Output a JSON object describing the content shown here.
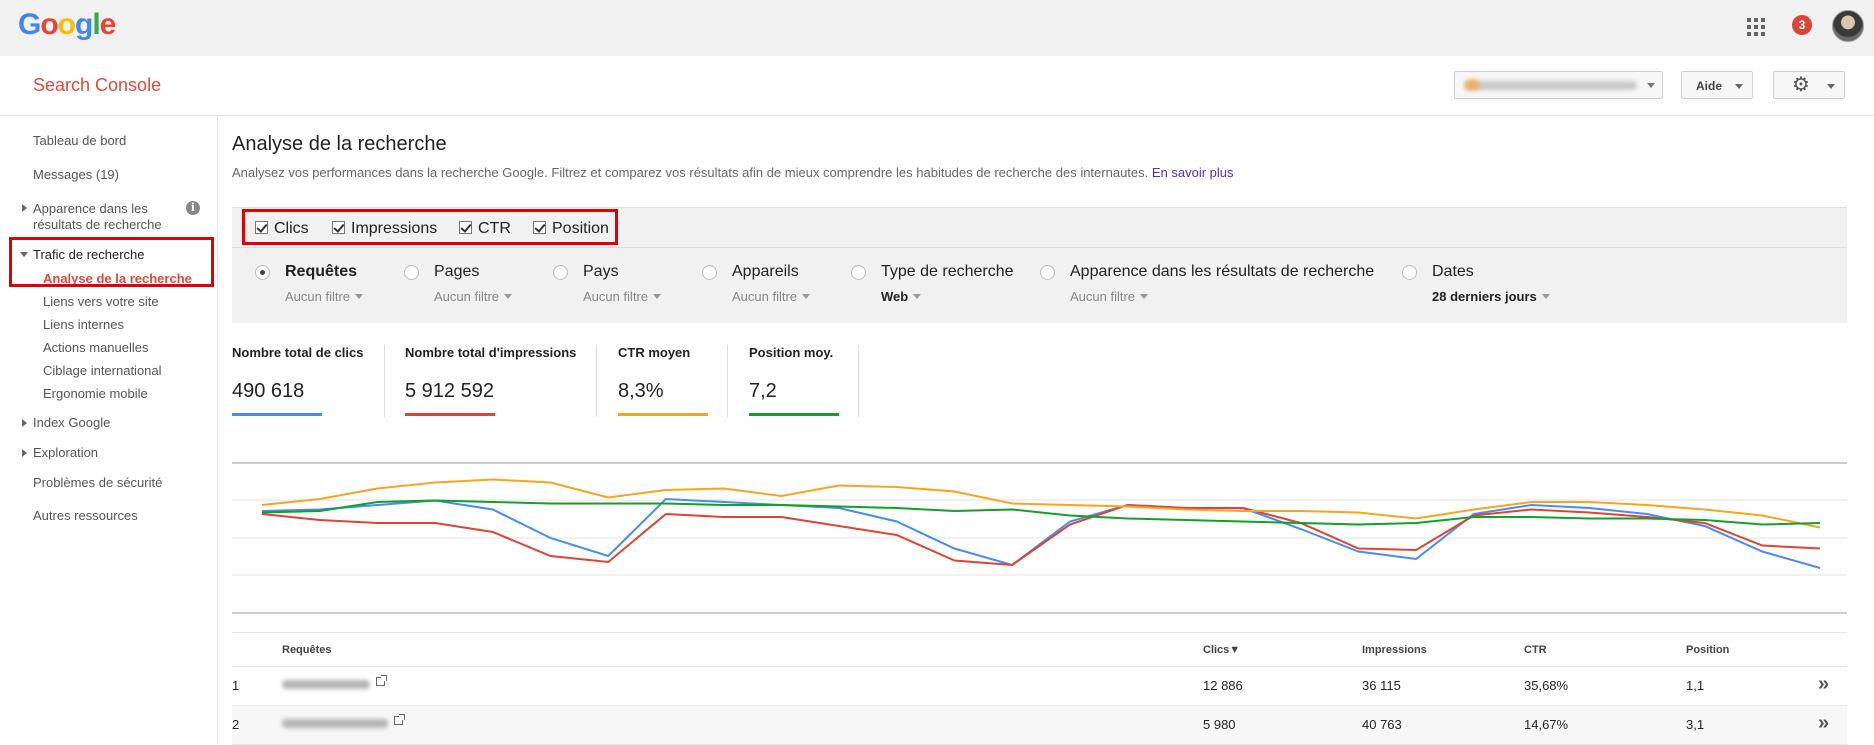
{
  "topbar": {
    "logo": [
      "G",
      "o",
      "o",
      "g",
      "l",
      "e"
    ],
    "logo_colors": [
      "#4285f4",
      "#ea4335",
      "#fbbc05",
      "#4285f4",
      "#34a853",
      "#ea4335"
    ],
    "notification_count": "3"
  },
  "header": {
    "title": "Search Console",
    "help_label": "Aide"
  },
  "sidebar": {
    "items": [
      {
        "label": "Tableau de bord"
      },
      {
        "label": "Messages (19)"
      },
      {
        "label": "Apparence dans les"
      },
      {
        "label": "résultats de recherche"
      },
      {
        "label": "Trafic de recherche"
      },
      {
        "label": "Index Google"
      },
      {
        "label": "Exploration"
      },
      {
        "label": "Problèmes de sécurité"
      },
      {
        "label": "Autres ressources"
      }
    ],
    "traffic_sub": [
      {
        "label": "Analyse de la recherche"
      },
      {
        "label": "Liens vers votre site"
      },
      {
        "label": "Liens internes"
      },
      {
        "label": "Actions manuelles"
      },
      {
        "label": "Ciblage international"
      },
      {
        "label": "Ergonomie mobile"
      }
    ]
  },
  "main": {
    "title": "Analyse de la recherche",
    "description": "Analysez vos performances dans la recherche Google. Filtrez et comparez vos résultats afin de mieux comprendre les habitudes de recherche des internautes.",
    "learn_more": "En savoir plus",
    "metrics": [
      "Clics",
      "Impressions",
      "CTR",
      "Position"
    ],
    "dimensions": [
      {
        "label": "Requêtes",
        "sub": "Aucun filtre",
        "selected": true
      },
      {
        "label": "Pages",
        "sub": "Aucun filtre"
      },
      {
        "label": "Pays",
        "sub": "Aucun filtre"
      },
      {
        "label": "Appareils",
        "sub": "Aucun filtre"
      },
      {
        "label": "Type de recherche",
        "sub": "Web"
      },
      {
        "label": "Apparence dans les résultats de recherche",
        "sub": "Aucun filtre"
      },
      {
        "label": "Dates",
        "sub": "28 derniers jours"
      }
    ],
    "kpis": [
      {
        "label": "Nombre total de clics",
        "value": "490 618",
        "color": "#4a8af4"
      },
      {
        "label": "Nombre total d'impressions",
        "value": "5 912 592",
        "color": "#db4437"
      },
      {
        "label": "CTR moyen",
        "value": "8,3%",
        "color": "#f4a522"
      },
      {
        "label": "Position moy.",
        "value": "7,2",
        "color": "#129f2b"
      }
    ]
  },
  "chart_data": {
    "type": "line",
    "series": [
      {
        "name": "Clics",
        "color": "#4a8af4",
        "values": [
          6.8,
          6.9,
          7.2,
          7.5,
          6.9,
          5.0,
          3.8,
          7.6,
          7.4,
          7.2,
          7.0,
          6.1,
          4.3,
          3.2,
          6.1,
          7.2,
          7.0,
          7.0,
          5.6,
          4.1,
          3.6,
          6.6,
          7.2,
          7.0,
          6.6,
          5.8,
          4.1,
          3.0
        ]
      },
      {
        "name": "Impressions",
        "color": "#db4437",
        "values": [
          6.6,
          6.2,
          6.0,
          6.0,
          5.4,
          3.8,
          3.4,
          6.6,
          6.4,
          6.4,
          5.8,
          5.2,
          3.5,
          3.2,
          5.9,
          7.2,
          7.0,
          7.0,
          6.0,
          4.3,
          4.2,
          6.5,
          6.9,
          6.7,
          6.4,
          6.0,
          4.5,
          4.3
        ]
      },
      {
        "name": "CTR",
        "color": "#f4a522",
        "values": [
          7.2,
          7.6,
          8.3,
          8.7,
          8.9,
          8.7,
          7.7,
          8.2,
          8.3,
          7.8,
          8.5,
          8.4,
          8.1,
          7.3,
          7.2,
          7.1,
          6.9,
          6.8,
          6.8,
          6.7,
          6.3,
          6.9,
          7.4,
          7.4,
          7.2,
          6.9,
          6.5,
          5.7
        ]
      },
      {
        "name": "Position",
        "color": "#129f2b",
        "values": [
          6.7,
          6.8,
          7.4,
          7.5,
          7.4,
          7.3,
          7.3,
          7.3,
          7.2,
          7.2,
          7.1,
          7.0,
          6.8,
          6.9,
          6.5,
          6.3,
          6.2,
          6.1,
          6.0,
          5.9,
          6.0,
          6.4,
          6.4,
          6.3,
          6.3,
          6.2,
          5.9,
          6.0
        ]
      }
    ]
  },
  "table": {
    "headers": [
      "Requêtes",
      "Clics▼",
      "Impressions",
      "CTR",
      "Position"
    ],
    "rows": [
      {
        "n": "1",
        "clicks": "12 886",
        "impressions": "36 115",
        "ctr": "35,68%",
        "position": "1,1"
      },
      {
        "n": "2",
        "clicks": "5 980",
        "impressions": "40 763",
        "ctr": "14,67%",
        "position": "3,1"
      }
    ],
    "expand_glyph": "»"
  }
}
